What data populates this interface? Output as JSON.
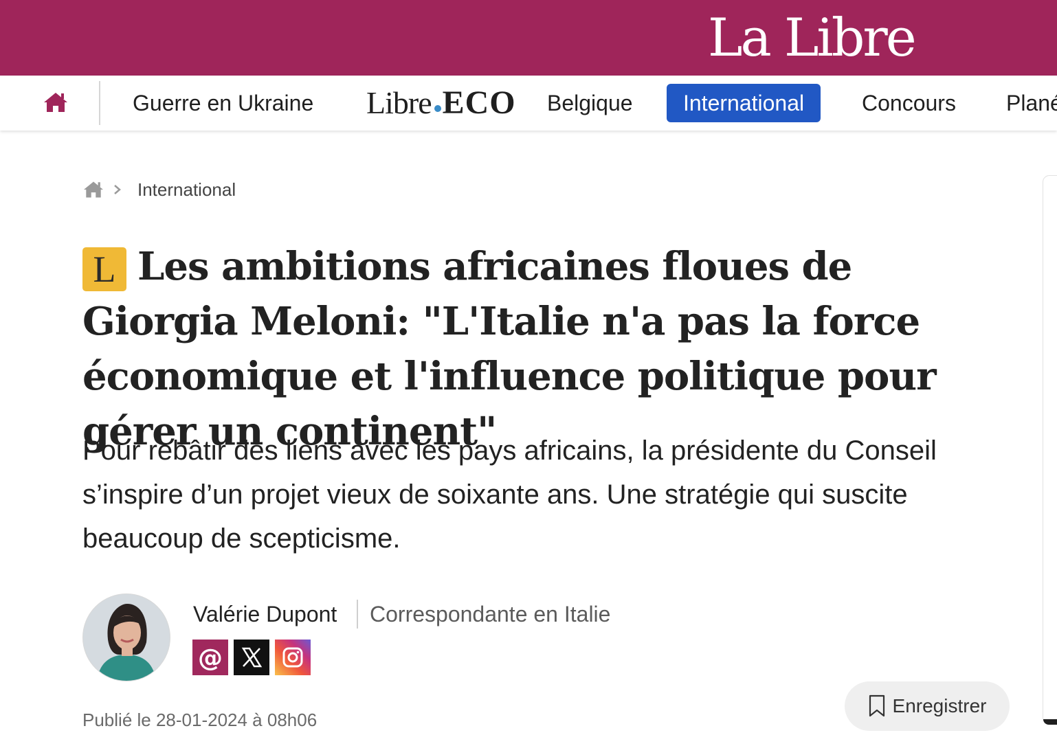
{
  "site": {
    "logo_text": "La Libre",
    "brand_color": "#9f255a"
  },
  "nav": {
    "home_icon": "home-icon",
    "items": [
      {
        "label": "Guerre en Ukraine"
      },
      {
        "label_part1": "Libre",
        "label_part2": "ECO"
      },
      {
        "label": "Belgique"
      },
      {
        "label": "International",
        "active": true,
        "active_color": "#2158c4"
      },
      {
        "label": "Concours"
      },
      {
        "label": "Plané"
      }
    ]
  },
  "breadcrumb": {
    "home_icon": "home-icon",
    "separator_icon": "chevron-right-icon",
    "current": "International"
  },
  "article": {
    "premium_badge": "L",
    "premium_badge_color": "#f0b936",
    "title": "Les ambitions africaines floues de Giorgia Meloni: \"L'Italie n'a pas la force économique et l'influence politique pour gérer un continent\"",
    "lead": "Pour rebâtir des liens avec les pays africains, la présidente du Conseil s’inspire d’un projet vieux de soixante ans. Une stratégie qui suscite beaucoup de scepticisme.",
    "author": {
      "name": "Valérie Dupont",
      "role": "Correspondante en Italie",
      "social": [
        "at-sign-icon",
        "x-logo-icon",
        "instagram-icon"
      ]
    },
    "published": "Publié le 28-01-2024 à 08h06",
    "save_label": "Enregistrer"
  }
}
